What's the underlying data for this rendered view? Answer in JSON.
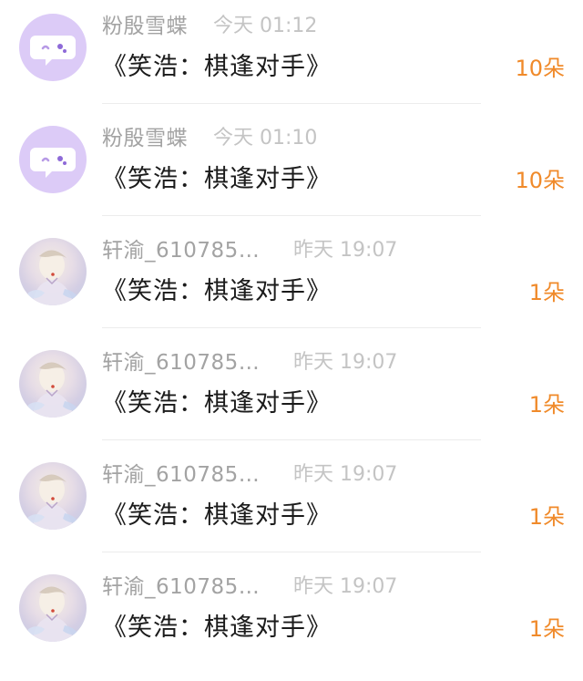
{
  "gifts": [
    {
      "avatar": "chat-bubble-icon",
      "sender": "粉殷雪蝶",
      "time": "今天 01:12",
      "title": "《笑浩：棋逢对手》",
      "count": "10朵"
    },
    {
      "avatar": "chat-bubble-icon",
      "sender": "粉殷雪蝶",
      "time": "今天 01:10",
      "title": "《笑浩：棋逢对手》",
      "count": "10朵"
    },
    {
      "avatar": "user-photo",
      "sender": "轩渝_610785…",
      "time": "昨天 19:07",
      "title": "《笑浩：棋逢对手》",
      "count": "1朵"
    },
    {
      "avatar": "user-photo",
      "sender": "轩渝_610785…",
      "time": "昨天 19:07",
      "title": "《笑浩：棋逢对手》",
      "count": "1朵"
    },
    {
      "avatar": "user-photo",
      "sender": "轩渝_610785…",
      "time": "昨天 19:07",
      "title": "《笑浩：棋逢对手》",
      "count": "1朵"
    },
    {
      "avatar": "user-photo",
      "sender": "轩渝_610785…",
      "time": "昨天 19:07",
      "title": "《笑浩：棋逢对手》",
      "count": "1朵"
    }
  ],
  "colors": {
    "count": "#f08a2a",
    "sender": "#a3a3a3",
    "time": "#c4c4c4",
    "title": "#1b1b1b",
    "app_avatar_bg": "#dccbf7"
  }
}
